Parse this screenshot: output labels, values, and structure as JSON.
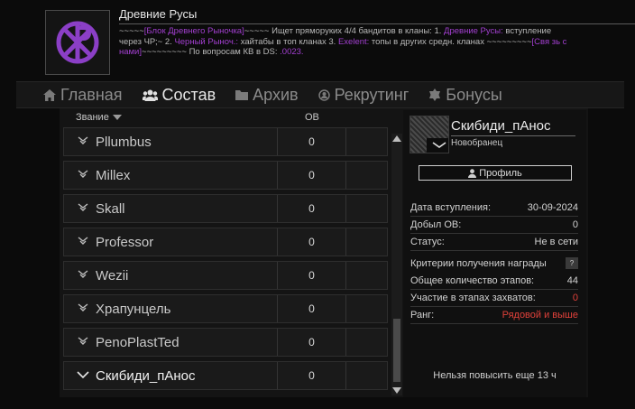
{
  "clan": {
    "name": "Древние Русы",
    "description": [
      {
        "t": "~~~~~",
        "p": false
      },
      {
        "t": "[Блок Древнего Рыночка]",
        "p": true
      },
      {
        "t": "~~~~~ Ищет пряморуких 4/4 бандитов в кланы: 1. ",
        "p": false
      },
      {
        "t": "Древние Русы:",
        "p": true
      },
      {
        "t": " вступление через ЧР;~ 2. ",
        "p": false
      },
      {
        "t": "Черный Рыноч.:",
        "p": true
      },
      {
        "t": " хайтабы в топ кланах 3. ",
        "p": false
      },
      {
        "t": "Exelent:",
        "p": true
      },
      {
        "t": " топы в других средн. кланах ~~~~~~~~~",
        "p": false
      },
      {
        "t": "[Свя зь с нами]",
        "p": true
      },
      {
        "t": "~~~~~~~~~ По вопросам КВ в DS: ",
        "p": false
      },
      {
        "t": ".0023.",
        "p": true
      }
    ]
  },
  "nav": {
    "home": "Главная",
    "roster": "Состав",
    "archive": "Архив",
    "recruiting": "Рекрутинг",
    "bonuses": "Бонусы"
  },
  "table": {
    "rank_header": "Звание",
    "ov_header": "ОВ",
    "rows": [
      {
        "name": "Pllumbus",
        "ov": "0"
      },
      {
        "name": "Millex",
        "ov": "0"
      },
      {
        "name": "Skall",
        "ov": "0"
      },
      {
        "name": "Professor",
        "ov": "0"
      },
      {
        "name": "Wezii",
        "ov": "0"
      },
      {
        "name": "Храпунцель",
        "ov": "0"
      },
      {
        "name": "PenoPlastTed",
        "ov": "0"
      },
      {
        "name": "Скибиди_пАнос",
        "ov": "0"
      }
    ]
  },
  "profile": {
    "name": "Скибиди_пАнос",
    "rank": "Новобранец",
    "button": "Профиль",
    "stats": [
      {
        "label": "Дата вступления:",
        "value": "30-09-2024"
      },
      {
        "label": "Добыл ОВ:",
        "value": "0"
      },
      {
        "label": "Статус:",
        "value": "Не в сети"
      }
    ],
    "reward_criteria": "Критерии получения награды",
    "help": "?",
    "stats2": [
      {
        "label": "Общее количество этапов:",
        "value": "44"
      },
      {
        "label": "Участие в этапах захватов:",
        "value": "0"
      },
      {
        "label": "Ранг:",
        "value": "Рядовой и выше"
      }
    ],
    "promote_note": "Нельзя повысить еще 13 ч"
  },
  "colors": {
    "accent_purple": "#a23fd0",
    "alert_red": "#e0413a",
    "emblem_purple": "#8b3fc6"
  }
}
